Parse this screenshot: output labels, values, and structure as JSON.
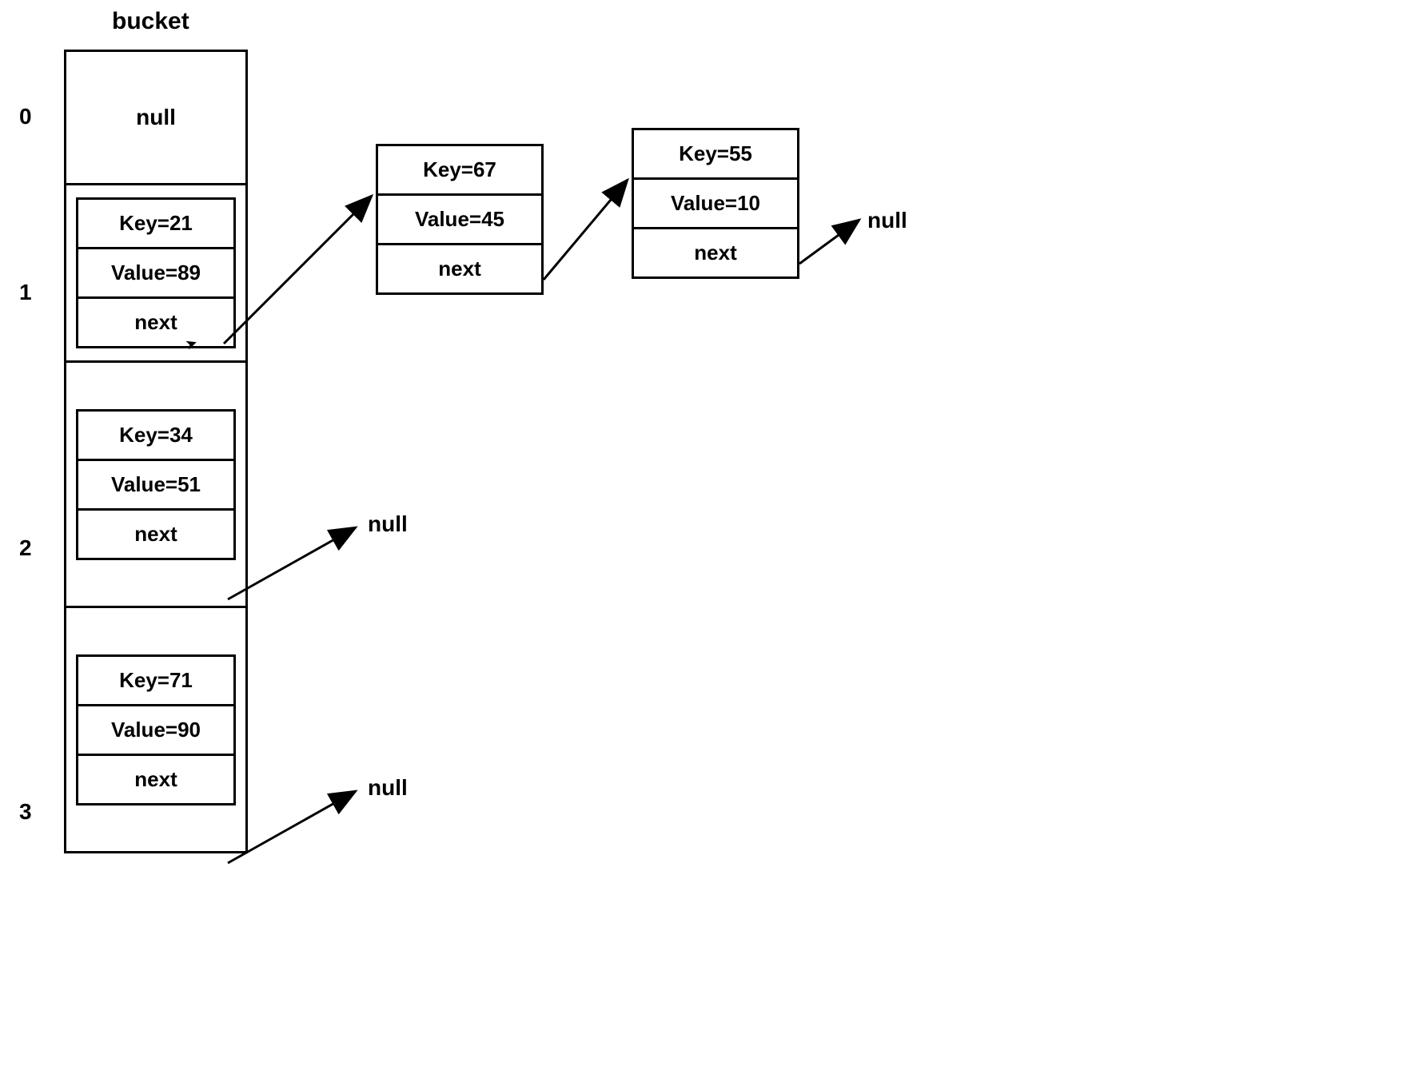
{
  "header": "bucket",
  "indices": [
    "0",
    "1",
    "2",
    "3"
  ],
  "bucket0": {
    "content": "null"
  },
  "bucket1": {
    "key": "Key=21",
    "value": "Value=89",
    "next": "next"
  },
  "chain1a": {
    "key": "Key=67",
    "value": "Value=45",
    "next": "next"
  },
  "chain1b": {
    "key": "Key=55",
    "value": "Value=10",
    "next": "next"
  },
  "chain1_end": "null",
  "bucket2": {
    "key": "Key=34",
    "value": "Value=51",
    "next": "next"
  },
  "chain2_end": "null",
  "bucket3": {
    "key": "Key=71",
    "value": "Value=90",
    "next": "next"
  },
  "chain3_end": "null"
}
